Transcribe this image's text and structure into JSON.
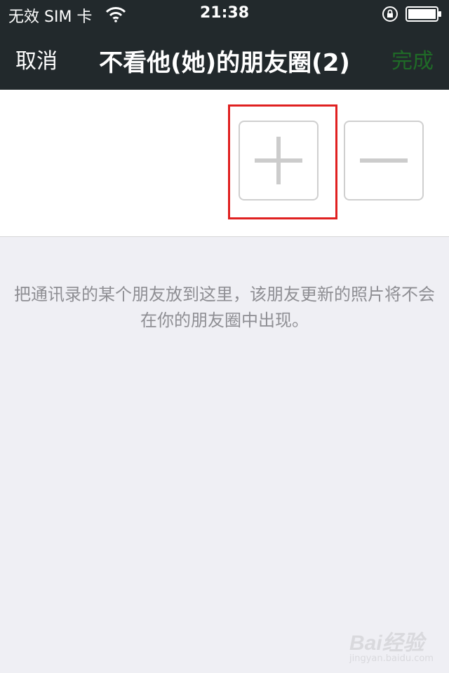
{
  "status_bar": {
    "carrier": "无效 SIM 卡",
    "time": "21:38",
    "icons": [
      "wifi-icon",
      "orientation-lock-icon",
      "battery-icon"
    ]
  },
  "nav": {
    "cancel_label": "取消",
    "title": "不看他(她)的朋友圈(2)",
    "done_label": "完成"
  },
  "member_grid": {
    "add_button_icon": "plus-icon",
    "remove_button_icon": "minus-icon"
  },
  "hint_text": "把通讯录的某个朋友放到这里，该朋友更新的照片将不会在你的朋友圈中出现。",
  "watermark": {
    "logo": "Bai经验",
    "sub": "jingyan.baidu.com"
  },
  "colors": {
    "top_bar": "#22292c",
    "done_text": "#1f6b27",
    "page_background": "#efeff4",
    "highlight_box": "#e02020"
  }
}
